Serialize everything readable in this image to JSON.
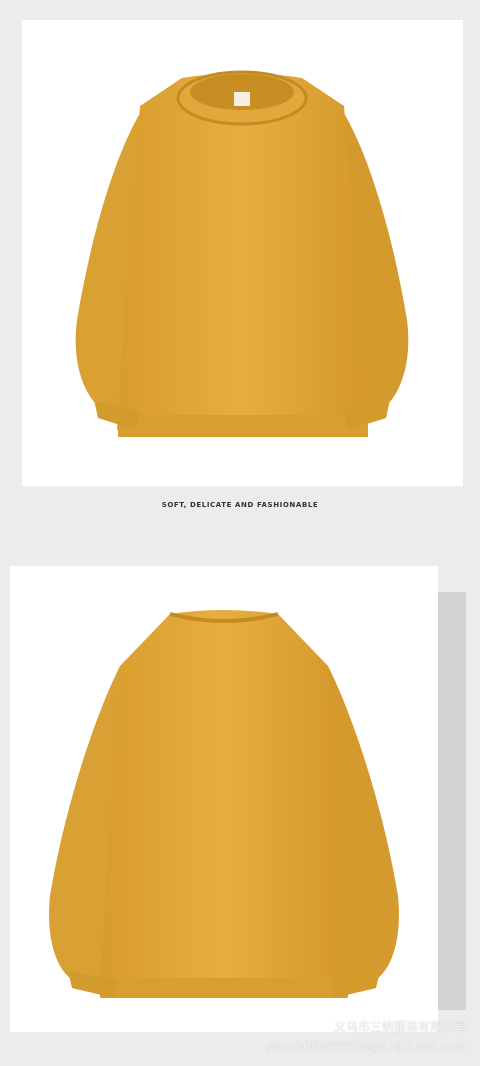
{
  "tagline": "SOFT, DELICATE AND FASHIONABLE",
  "watermark": {
    "company": "义乌市三妍服装有限公司",
    "url": "shop3060999989g678.1688.com"
  },
  "product": {
    "color_hex": "#E0A83A",
    "views": [
      "front",
      "back"
    ]
  }
}
